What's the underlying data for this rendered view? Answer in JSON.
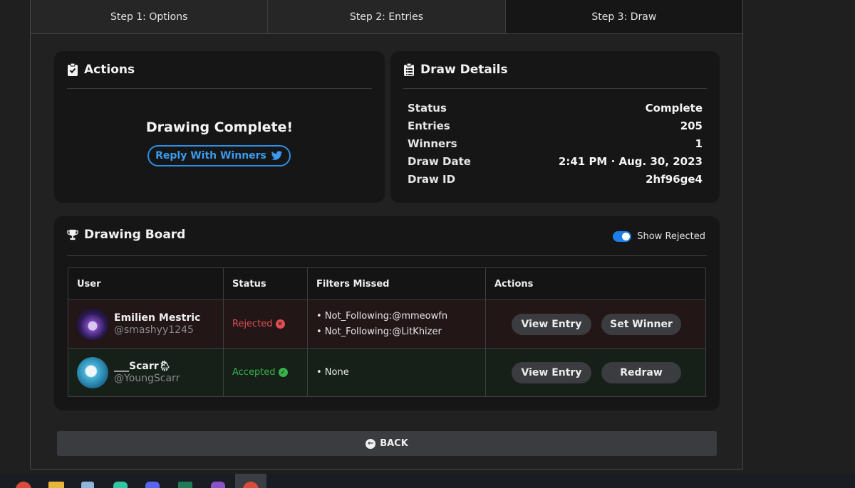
{
  "steps": [
    "Step 1: Options",
    "Step 2: Entries",
    "Step 3: Draw"
  ],
  "actions": {
    "title": "Actions",
    "complete_text": "Drawing Complete!",
    "reply_label": "Reply With Winners"
  },
  "details": {
    "title": "Draw Details",
    "rows": [
      {
        "label": "Status",
        "value": "Complete"
      },
      {
        "label": "Entries",
        "value": "205"
      },
      {
        "label": "Winners",
        "value": "1"
      },
      {
        "label": "Draw Date",
        "value": "2:41 PM · Aug. 30, 2023"
      },
      {
        "label": "Draw ID",
        "value": "2hf96ge4"
      }
    ]
  },
  "board": {
    "title": "Drawing Board",
    "toggle_label": "Show Rejected",
    "toggle_on": true,
    "columns": [
      "User",
      "Status",
      "Filters Missed",
      "Actions"
    ],
    "rows": [
      {
        "name": "Emilien Mestric",
        "handle": "@smashyy1245",
        "status": "Rejected",
        "filters": [
          "• Not_Following:@mmeowfn",
          "• Not_Following:@LitKhizer"
        ],
        "btn1": "View Entry",
        "btn2": "Set Winner"
      },
      {
        "name": "___Scarr🌦",
        "handle": "@YoungScarr",
        "status": "Accepted",
        "filters": [
          "• None"
        ],
        "btn1": "View Entry",
        "btn2": "Redraw"
      }
    ]
  },
  "back_label": "BACK",
  "colors": {
    "accent": "#2d8fe6",
    "rejected": "#e04e52",
    "accepted": "#35b24a"
  },
  "taskbar_icons": [
    "chrome-icon",
    "folder-icon",
    "notepad-icon",
    "app-icon",
    "discord-icon",
    "excel-icon",
    "game-icon",
    "chrome-active-icon"
  ]
}
